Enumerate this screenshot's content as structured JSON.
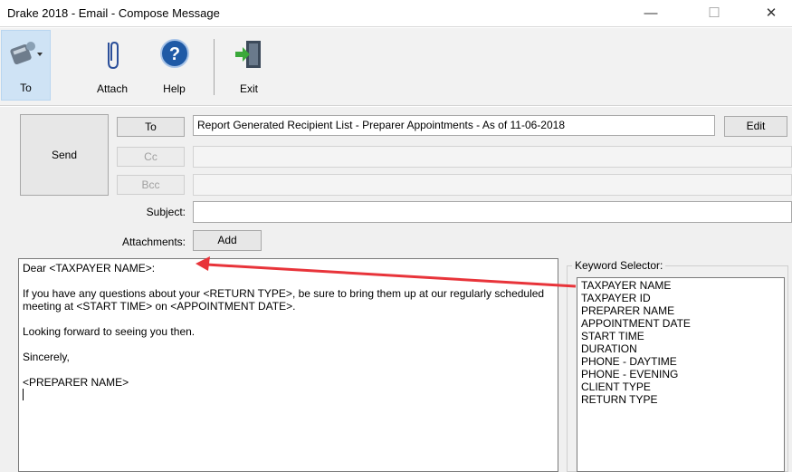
{
  "window": {
    "title": "Drake 2018 - Email - Compose Message",
    "minimize_glyph": "—",
    "maximize_glyph": "☐",
    "close_glyph": "✕"
  },
  "toolbar": {
    "to_label": "To",
    "attach_label": "Attach",
    "help_label": "Help",
    "exit_label": "Exit"
  },
  "compose": {
    "send_label": "Send",
    "to_button": "To",
    "cc_button": "Cc",
    "bcc_button": "Bcc",
    "to_value": "Report Generated Recipient List - Preparer Appointments - As of 11-06-2018",
    "cc_value": "",
    "bcc_value": "",
    "edit_label": "Edit",
    "subject_label": "Subject:",
    "subject_value": "",
    "attachments_label": "Attachments:",
    "add_label": "Add"
  },
  "body": {
    "lines": [
      "Dear <TAXPAYER NAME>:",
      "If you have any questions about your <RETURN TYPE>, be sure to bring them up at our regularly scheduled meeting at <START TIME> on <APPOINTMENT DATE>.",
      "Looking forward to seeing you then.",
      "Sincerely,",
      "<PREPARER NAME>"
    ]
  },
  "keyword_selector": {
    "title": "Keyword Selector:",
    "items": [
      "TAXPAYER NAME",
      "TAXPAYER ID",
      "PREPARER NAME",
      "APPOINTMENT DATE",
      "START TIME",
      "DURATION",
      "PHONE - DAYTIME",
      "PHONE - EVENING",
      "CLIENT TYPE",
      "RETURN TYPE"
    ]
  },
  "colors": {
    "arrow": "#e8343a",
    "selected_tool_bg": "#cfe3f5",
    "help_icon": "#1f5aa6",
    "exit_icon": "#3aa83a"
  }
}
